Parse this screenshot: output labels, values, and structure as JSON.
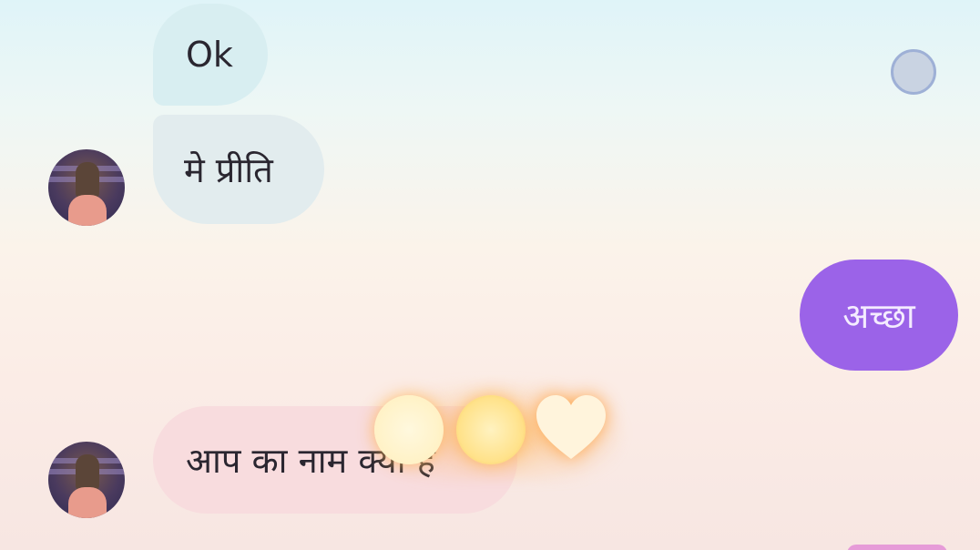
{
  "messages": [
    {
      "id": "ok",
      "text": "Ok",
      "side": "left"
    },
    {
      "id": "name",
      "text": "मे प्रीति",
      "side": "left"
    },
    {
      "id": "acha",
      "text": "अच्छा",
      "side": "right"
    },
    {
      "id": "question",
      "text": "आप का नाम क्या है",
      "side": "left"
    }
  ],
  "colors": {
    "sent_bubble": "#9b63e8",
    "received_bubble_1": "#d8eef1",
    "received_bubble_2": "#e2ecee",
    "received_bubble_3": "#f8dcde"
  },
  "reactions": [
    "glow-dot",
    "glow-dot",
    "heart-icon"
  ]
}
